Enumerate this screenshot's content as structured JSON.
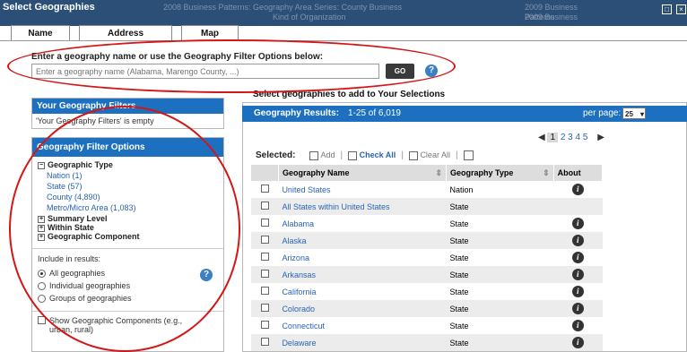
{
  "window": {
    "title": "Select Geographies",
    "bg_text_1": "2008 Business Patterns: Geography Area Series: County Business",
    "bg_text_2": "Kind of Organization",
    "bg_text_3": "2009 Business Patterns",
    "bg_text_4": "2009 Business"
  },
  "tabs": [
    {
      "label": "Name"
    },
    {
      "label": "Address"
    },
    {
      "label": "Map"
    }
  ],
  "search": {
    "label": "Enter a geography name or use the Geography Filter Options below:",
    "placeholder": "Enter a geography name (Alabama, Marengo County, ...)",
    "go_label": "GO",
    "help": "?"
  },
  "filters": {
    "header": "Your Geography Filters",
    "empty_text": "'Your Geography Filters' is empty"
  },
  "filter_options": {
    "header": "Geography Filter Options",
    "geographic_type_label": "Geographic Type",
    "types": [
      {
        "label": "Nation (1)"
      },
      {
        "label": "State (57)"
      },
      {
        "label": "County (4,890)"
      },
      {
        "label": "Metro/Micro Area (1,083)"
      }
    ],
    "summary_level": "Summary Level",
    "within_state": "Within State",
    "geographic_component": "Geographic Component",
    "include_label": "Include in results:",
    "include_options": [
      {
        "label": "All geographies"
      },
      {
        "label": "Individual geographies"
      },
      {
        "label": "Groups of geographies"
      }
    ],
    "show_components_label": "Show Geographic Components (e.g., urban, rural)"
  },
  "results": {
    "select_header": "Select geographies to add to Your Selections",
    "results_label": "Geography Results:",
    "results_range": "1-25 of 6,019",
    "per_page_label": "per page:",
    "per_page_value": "25",
    "pages": [
      "1",
      "2",
      "3",
      "4",
      "5"
    ],
    "selected_label": "Selected:",
    "add_label": "Add",
    "check_all_label": "Check All",
    "clear_all_label": "Clear All",
    "columns": {
      "name": "Geography Name",
      "type": "Geography Type",
      "about": "About"
    },
    "rows": [
      {
        "name": "United States",
        "type": "Nation"
      },
      {
        "name": "All States within United States",
        "type": "State"
      },
      {
        "name": "Alabama",
        "type": "State"
      },
      {
        "name": "Alaska",
        "type": "State"
      },
      {
        "name": "Arizona",
        "type": "State"
      },
      {
        "name": "Arkansas",
        "type": "State"
      },
      {
        "name": "California",
        "type": "State"
      },
      {
        "name": "Colorado",
        "type": "State"
      },
      {
        "name": "Connecticut",
        "type": "State"
      },
      {
        "name": "Delaware",
        "type": "State"
      }
    ]
  },
  "colors": {
    "accent": "#1d6fbf",
    "titlebar": "#2c4f78",
    "annotation": "#d41616"
  }
}
